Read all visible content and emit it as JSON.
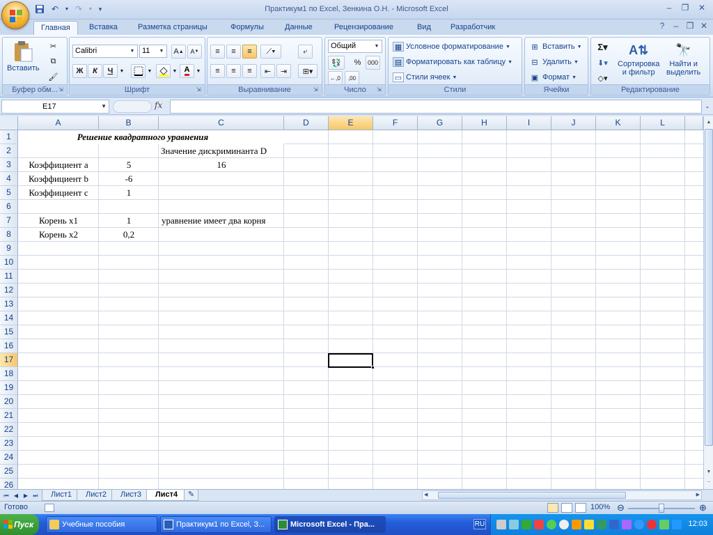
{
  "window": {
    "title": "Практикум1 по Excel, Зенкина О.Н. - Microsoft Excel"
  },
  "tabs": [
    "Главная",
    "Вставка",
    "Разметка страницы",
    "Формулы",
    "Данные",
    "Рецензирование",
    "Вид",
    "Разработчик"
  ],
  "ribbon": {
    "clipboard": {
      "label": "Буфер обм...",
      "paste": "Вставить"
    },
    "font": {
      "label": "Шрифт",
      "name": "Calibri",
      "size": "11",
      "bold": "Ж",
      "italic": "К",
      "underline": "Ч"
    },
    "alignment": {
      "label": "Выравнивание"
    },
    "number": {
      "label": "Число",
      "format": "Общий",
      "percent": "%",
      "thousands": "000"
    },
    "styles": {
      "label": "Стили",
      "conditional": "Условное форматирование",
      "table": "Форматировать как таблицу",
      "cell_styles": "Стили ячеек"
    },
    "cells": {
      "label": "Ячейки",
      "insert": "Вставить",
      "delete": "Удалить",
      "format": "Формат"
    },
    "editing": {
      "label": "Редактирование",
      "sort": "Сортировка",
      "sort2": "и фильтр",
      "find": "Найти и",
      "find2": "выделить"
    }
  },
  "formula_bar": {
    "name_box": "E17",
    "fx": "fx",
    "value": ""
  },
  "sheet": {
    "columns": [
      "A",
      "B",
      "C",
      "D",
      "E",
      "F",
      "G",
      "H",
      "I",
      "J",
      "K",
      "L"
    ],
    "selected_column": "E",
    "selected_row": 17,
    "rows": [
      "1",
      "2",
      "3",
      "4",
      "5",
      "6",
      "7",
      "8",
      "9",
      "10",
      "11",
      "12",
      "13",
      "14",
      "15",
      "16",
      "17",
      "18",
      "19",
      "20",
      "21",
      "22",
      "23",
      "24",
      "25",
      "26"
    ],
    "cells": {
      "title": "Решение квадратного уравнения",
      "disc_label": "Значение дискриминанта D",
      "coef_a_label": "Коэффициент a",
      "coef_a": "5",
      "disc_value": "16",
      "coef_b_label": "Коэффициент b",
      "coef_b": "-6",
      "coef_c_label": "Коэффициент c",
      "coef_c": "1",
      "root1_label": "Корень x1",
      "root1": "1",
      "roots_msg": "уравнение имеет два корня",
      "root2_label": "Корень x2",
      "root2": "0,2"
    }
  },
  "sheet_tabs": [
    "Лист1",
    "Лист2",
    "Лист3",
    "Лист4"
  ],
  "active_sheet": "Лист4",
  "status": {
    "ready": "Готово",
    "zoom": "100%"
  },
  "taskbar": {
    "start": "Пуск",
    "buttons": [
      "Учебные пособия",
      "Практикум1 по Excel, З...",
      "Microsoft Excel - Пра..."
    ],
    "lang": "RU",
    "clock": "12:03"
  },
  "colors": {
    "accent": "#15428b",
    "selection": "#f8c66a",
    "taskbar": "#245edb"
  }
}
